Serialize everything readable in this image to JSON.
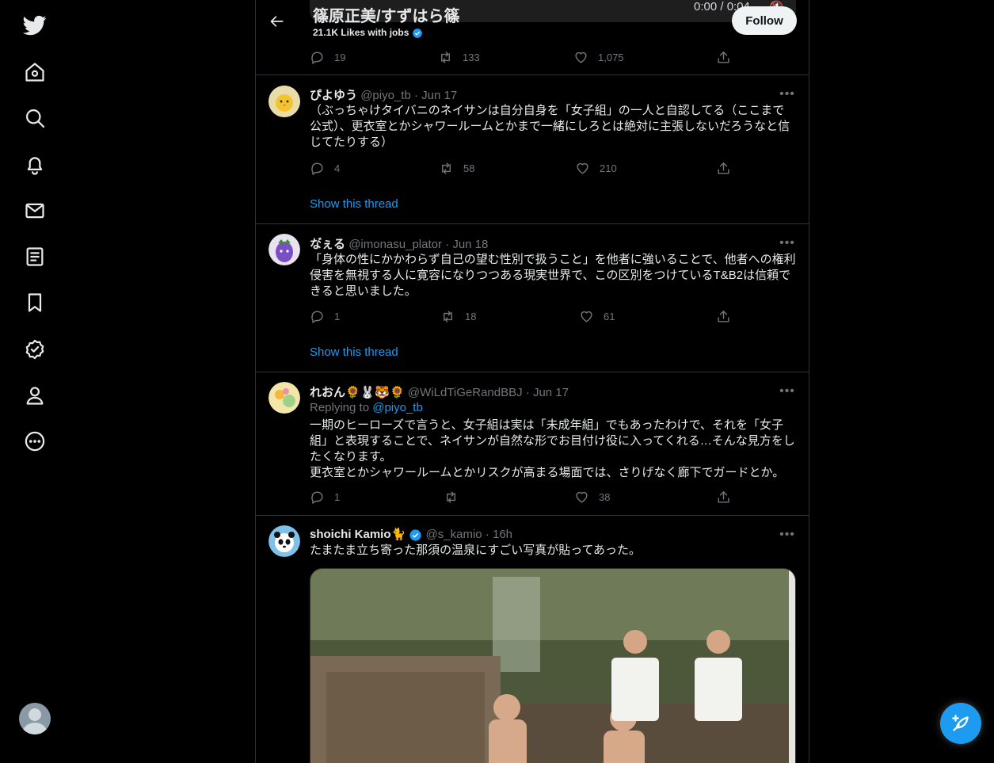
{
  "nav": {
    "items": [
      "twitter-logo",
      "home",
      "explore",
      "notifications",
      "messages",
      "lists",
      "bookmarks",
      "verified",
      "profile",
      "more"
    ]
  },
  "header": {
    "profile_name": "篠原正美/すずはら篠",
    "sub_text": "21.1K Likes",
    "sub_overlay": "with jobs",
    "follow_label": "Follow",
    "video_time": "0:00 / 0:04",
    "stats": {
      "replies": "19",
      "retweets": "133",
      "likes": "1,075"
    }
  },
  "tweets": [
    {
      "name": "ぴよゆう",
      "handle": "@piyo_tb",
      "date": "Jun 17",
      "text": "（ぶっちゃけタイバニのネイサンは自分自身を「女子組」の一人と自認してる（ここまで公式）、更衣室とかシャワールームとかまで一緒にしろとは絶対に主張しないだろうなと信じてたりする）",
      "replies": "4",
      "retweets": "58",
      "likes": "210",
      "show_thread": "Show this thread"
    },
    {
      "name": "な゙ぇる",
      "handle": "@imonasu_plator",
      "date": "Jun 18",
      "text": "「身体の性にかかわらず自己の望む性別で扱うこと」を他者に強いることで、他者への権利侵害を無視する人に寛容になりつつある現実世界で、この区別をつけているT&B2は信頼できると思いました。",
      "replies": "1",
      "retweets": "18",
      "likes": "61",
      "show_thread": "Show this thread"
    },
    {
      "name": "れおん🌻🐰🐯🌻",
      "handle": "@WiLdTiGeRandBBJ",
      "date": "Jun 17",
      "replying_label": "Replying to",
      "replying_to": "@piyo_tb",
      "text": "一期のヒーローズで言うと、女子組は実は「未成年組」でもあったわけで、それを「女子組」と表現することで、ネイサンが自然な形でお目付け役に入ってくれる…そんな見方をしたくなります。\n更衣室とかシャワールームとかリスクが高まる場面では、さりげなく廊下でガードとか。",
      "replies": "1",
      "retweets": "",
      "likes": "38"
    },
    {
      "name": "shoichi Kamio🐈",
      "handle": "@s_kamio",
      "date": "16h",
      "text": "たまたま立ち寄った那須の温泉にすごい写真が貼ってあった。"
    }
  ],
  "colors": {
    "accent": "#1d9bf0",
    "background": "#000000",
    "text": "#e7e9ea",
    "muted": "#71767b",
    "border": "#2f3336"
  }
}
